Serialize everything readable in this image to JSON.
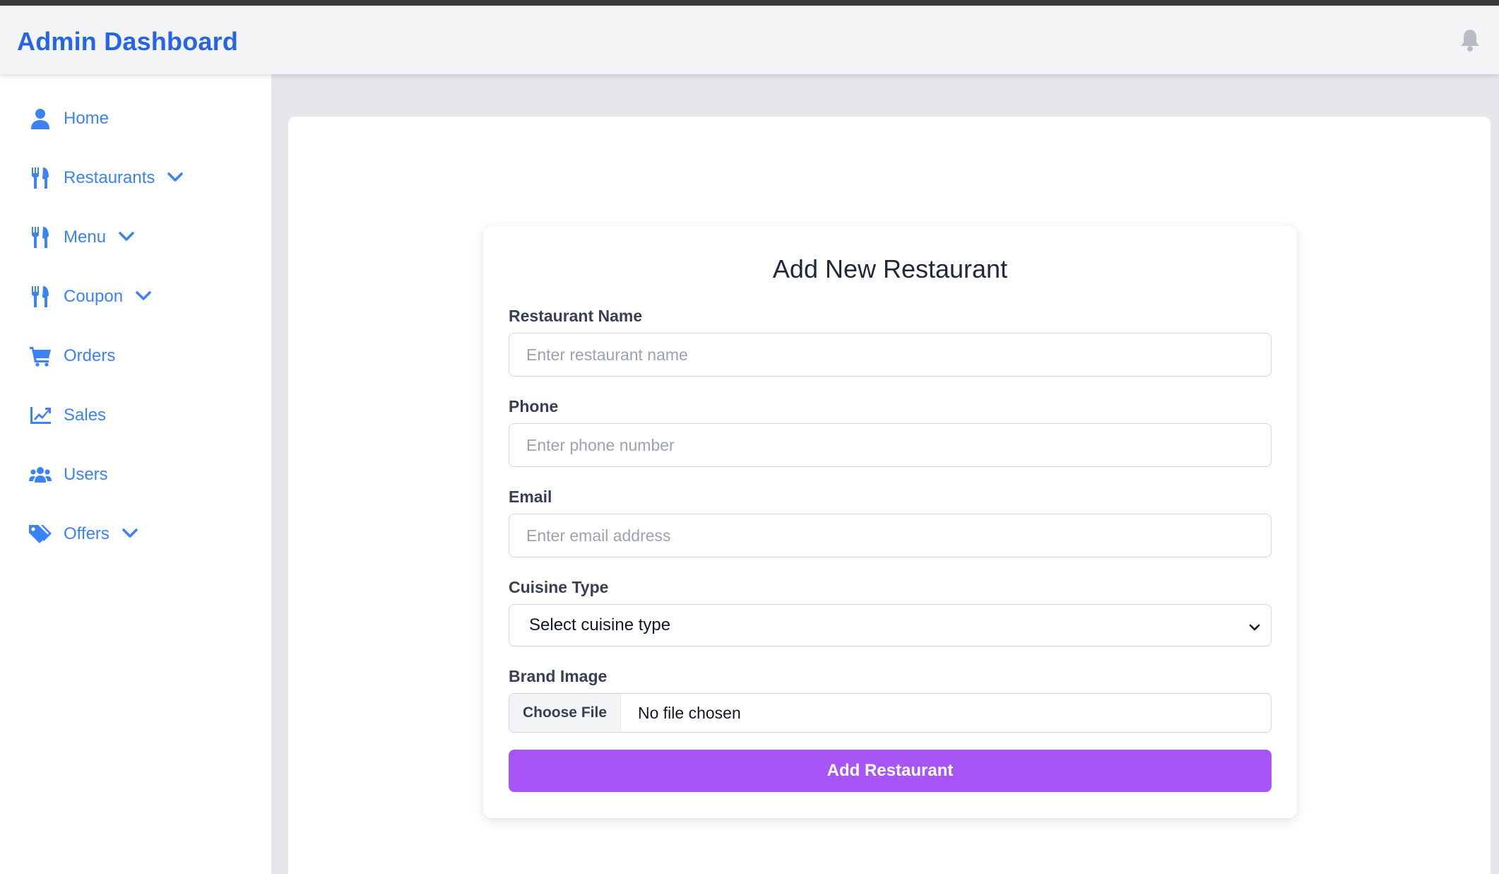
{
  "header": {
    "title": "Admin Dashboard",
    "notification_icon": "bell-icon"
  },
  "sidebar": {
    "items": [
      {
        "label": "Home",
        "icon": "user-icon",
        "has_dropdown": false
      },
      {
        "label": "Restaurants",
        "icon": "utensils-icon",
        "has_dropdown": true
      },
      {
        "label": "Menu",
        "icon": "utensils-icon",
        "has_dropdown": true
      },
      {
        "label": "Coupon",
        "icon": "utensils-icon",
        "has_dropdown": true
      },
      {
        "label": "Orders",
        "icon": "cart-icon",
        "has_dropdown": false
      },
      {
        "label": "Sales",
        "icon": "chart-line-icon",
        "has_dropdown": false
      },
      {
        "label": "Users",
        "icon": "users-icon",
        "has_dropdown": false
      },
      {
        "label": "Offers",
        "icon": "tags-icon",
        "has_dropdown": true
      }
    ]
  },
  "form": {
    "title": "Add New Restaurant",
    "fields": {
      "name": {
        "label": "Restaurant Name",
        "placeholder": "Enter restaurant name",
        "value": ""
      },
      "phone": {
        "label": "Phone",
        "placeholder": "Enter phone number",
        "value": ""
      },
      "email": {
        "label": "Email",
        "placeholder": "Enter email address",
        "value": ""
      },
      "cuisine": {
        "label": "Cuisine Type",
        "selected": "Select cuisine type"
      },
      "image": {
        "label": "Brand Image",
        "button_label": "Choose File",
        "status": "No file chosen"
      }
    },
    "submit_label": "Add Restaurant"
  },
  "colors": {
    "brand": "#2563eb",
    "nav": "#3b82f6",
    "submit": "#a855f7"
  }
}
